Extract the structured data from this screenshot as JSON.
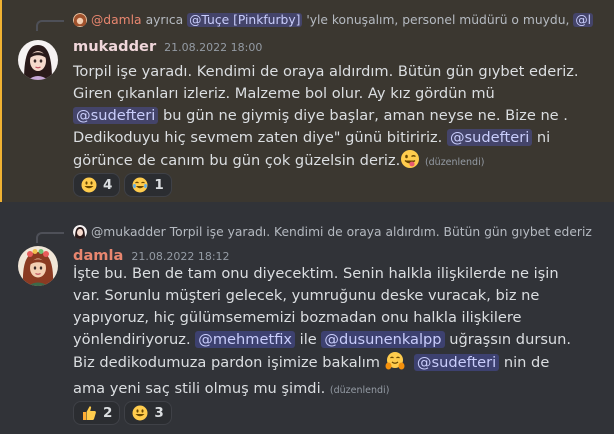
{
  "messages": [
    {
      "author": "mukadder",
      "author_color": "#f0d6da",
      "timestamp": "21.08.2022 18:00",
      "reply": {
        "author": "@damla",
        "author_color": "#e8866f",
        "text_before": "ayrıca",
        "mention1": "@Tuçe [Pinkfurby]",
        "text_after": "'yle konuşalım, personel müdürü o muydu,",
        "mention2": "@l"
      },
      "body": {
        "p1": "Torpil işe yaradı. Kendimi de oraya aldırdım. Bütün gün gıybet ederiz. Giren çıkanları izleriz. Malzeme bol olur. Ay kız gördün mü ",
        "m1": "@sudefteri",
        "p2": " bu gün ne giymiş diye  başlar, aman neyse ne. Bize ne . Dedikoduyu hiç sevmem zaten diye\" günü bitiririz. ",
        "m2": "@sudefteri",
        "p3": " ni görünce de canım bu gün çok güzelsin deriz.",
        "emoji": "winking-tongue-emoji",
        "edited": "(düzenlendi)"
      },
      "reactions": [
        {
          "emoji": "grinning-face-emoji",
          "count": "4"
        },
        {
          "emoji": "tears-of-joy-emoji",
          "count": "1"
        }
      ]
    },
    {
      "author": "damla",
      "author_color": "#e8866f",
      "timestamp": "21.08.2022 18:12",
      "reply": {
        "author": "@mukadder",
        "author_color": "#b5bac1",
        "text": "Torpil işe yaradı. Kendimi de oraya aldırdım. Bütün gün gıybet ederiz"
      },
      "body": {
        "p1": "İşte bu. Ben de tam onu diyecektim. Senin halkla ilişkilerde ne işin var. Sorunlu müşteri gelecek, yumruğunu deske vuracak, biz ne yapıyoruz, hiç gülümsememizi bozmadan onu halkla ilişkilere yönlendiriyoruz. ",
        "m1": "@mehmetfix",
        "p2": " ile ",
        "m2": "@dusunenkalpp",
        "p3": " uğraşsın dursun. Biz dedikodumuza pardon işimize bakalım ",
        "emoji": "hugging-face-emoji",
        "p4": "  ",
        "m3": "@sudefteri",
        "p5": " nin de ama yeni saç stili olmuş mu şimdi.",
        "edited": "(düzenlendi)"
      },
      "reactions": [
        {
          "emoji": "thumbs-up-emoji",
          "count": "2"
        },
        {
          "emoji": "grinning-face-emoji",
          "count": "3"
        }
      ]
    }
  ]
}
